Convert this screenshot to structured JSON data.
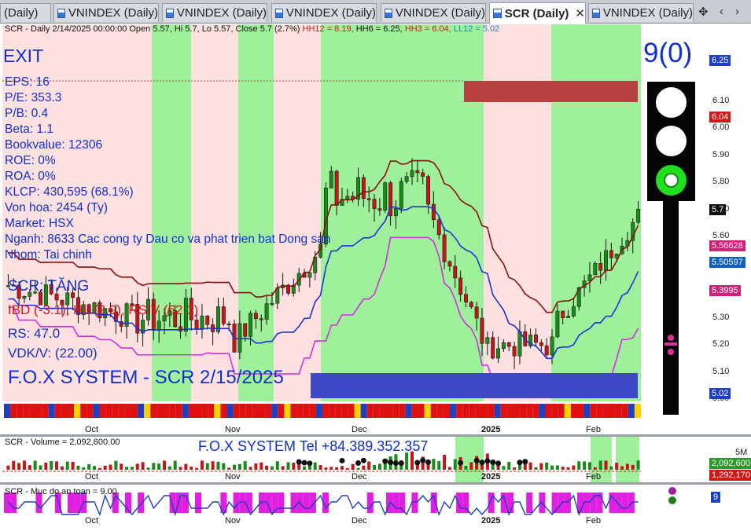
{
  "tabs": [
    {
      "label": "(Daily)",
      "active": false
    },
    {
      "label": "VNINDEX (Daily)",
      "active": false
    },
    {
      "label": "VNINDEX (Daily)",
      "active": false
    },
    {
      "label": "VNINDEX (Daily)",
      "active": false
    },
    {
      "label": "VNINDEX (Daily)",
      "active": false
    },
    {
      "label": "SCR (Daily)",
      "active": true,
      "close": "✕"
    },
    {
      "label": "VNINDEX (Daily)",
      "active": false
    }
  ],
  "nav": {
    "prev": "‹",
    "next": "›"
  },
  "price_pane": {
    "header": {
      "main": "SCR - Daily 2/14/2025 00:00:00 Open 5.57, Hi 5.7, Lo 5.57, Close 5.7 (2.7%)",
      "hh12": "HH12 = 8.19,",
      "hh6": "HH6 = 6.25,",
      "hh3": "HH3 = 6.04,",
      "ll12": "LL12 = 5.02"
    },
    "signal": "EXIT",
    "fundamentals": [
      "EPS: 16",
      "P/E: 353.3",
      "P/B: 0.4",
      "Beta: 1.1",
      "Bookvalue: 12306",
      "ROE: 0%",
      "ROA: 0%",
      "KLCP: 430,595 (68.1%)",
      "Von hoa: 2454 (Ty)",
      "Market: HSX",
      "Nganh: 8633 Cac cong ty Dau co va phat trien bat Dong san",
      "Nhom: Tai chinh"
    ],
    "trend": "SCR: TĂNG",
    "indicators": "IBD (-3.1), HL (2.9), RSIV (62.1)",
    "rs": "RS: 47.0",
    "vdk": "VDK/V:  (22.00)",
    "watermark": "F.O.X SYSTEM - SCR 2/15/2025",
    "counter": "9(0)",
    "scale_ticks": [
      "6.10",
      "6.00",
      "5.90",
      "5.80",
      "5.70",
      "5.60",
      "5.50",
      "5.40",
      "5.30",
      "5.20",
      "5.10",
      "5.00"
    ],
    "flags": [
      {
        "label": "6.25",
        "color": "#1f3fbf"
      },
      {
        "label": "6.04",
        "color": "#d01818"
      },
      {
        "label": "5.7",
        "color": "#111111"
      },
      {
        "label": "5.56628",
        "color": "#d0207a"
      },
      {
        "label": "5.50597",
        "color": "#1060c0"
      },
      {
        "label": "5.3995",
        "color": "#d0207a"
      },
      {
        "label": "5.02",
        "color": "#1f3fbf"
      }
    ],
    "months": [
      "Oct",
      "Nov",
      "Dec",
      "2025",
      "Feb"
    ]
  },
  "volume_pane": {
    "header": "SCR - Volume = 2,092,600.00",
    "contact": "F.O.X SYSTEM Tel +84.389.352.357",
    "scale_tick": "5M",
    "flags": [
      {
        "label": "2,092,600",
        "color": "#2a9a2a"
      },
      {
        "label": "1,292,170",
        "color": "#d01818"
      }
    ],
    "months": [
      "Oct",
      "Nov",
      "Dec",
      "2025",
      "Feb"
    ]
  },
  "safety_pane": {
    "header": "SCR - Muc do an toan = 9.00",
    "flag": {
      "label": "9",
      "color": "#1f3fbf"
    },
    "months": [
      "Oct",
      "Nov",
      "Dec",
      "2025",
      "Feb"
    ]
  },
  "colors": {
    "bull_zone": "#9ff09a",
    "bear_zone": "#fde0e0",
    "up_candle": "#1a8a1a",
    "down_candle": "#c01818",
    "cloud": "#00e8ff",
    "tenkan": "#1c32d8",
    "kijun": "#8a1010",
    "support": "#d030e0"
  }
}
